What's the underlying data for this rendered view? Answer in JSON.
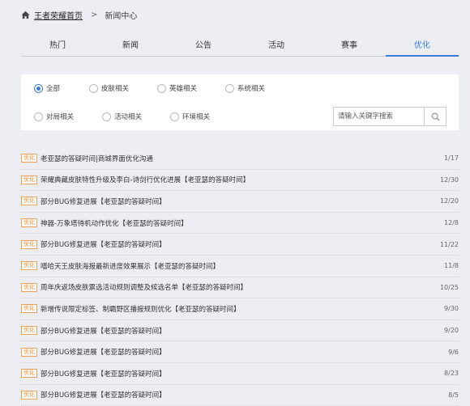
{
  "breadcrumb": {
    "home": "王者荣耀首页",
    "separator": ">",
    "current": "新闻中心"
  },
  "tabs": [
    {
      "label": "热门"
    },
    {
      "label": "新闻"
    },
    {
      "label": "公告"
    },
    {
      "label": "活动"
    },
    {
      "label": "赛事"
    },
    {
      "label": "优化"
    }
  ],
  "filters": [
    {
      "label": "全部"
    },
    {
      "label": "皮肤相关"
    },
    {
      "label": "英雄相关"
    },
    {
      "label": "系统相关"
    },
    {
      "label": "对局相关"
    },
    {
      "label": "活动相关"
    },
    {
      "label": "环境相关"
    }
  ],
  "search": {
    "placeholder": "请输入关键字搜索"
  },
  "news": [
    {
      "tag": "优化",
      "title": "老亚瑟的答疑时间|商城界面优化沟通",
      "date": "1/17"
    },
    {
      "tag": "优化",
      "title": "荣耀典藏皮肤特性升级及李白-诗剑行优化进展【老亚瑟的答疑时间】",
      "date": "12/30"
    },
    {
      "tag": "优化",
      "title": "部分BUG修复进展【老亚瑟的答疑时间】",
      "date": "12/20"
    },
    {
      "tag": "优化",
      "title": "神器-万象塔待机动作优化【老亚瑟的答疑时间】",
      "date": "12/8"
    },
    {
      "tag": "优化",
      "title": "部分BUG修复进展【老亚瑟的答疑时间】",
      "date": "11/22"
    },
    {
      "tag": "优化",
      "title": "嘻哈天王皮肤海报最新进度效果展示【老亚瑟的答疑时间】",
      "date": "11/8"
    },
    {
      "tag": "优化",
      "title": "周年庆返场皮肤票选活动规则调整及候选名单【老亚瑟的答疑时间】",
      "date": "10/25"
    },
    {
      "tag": "优化",
      "title": "新增传说限定标签、制霸野区播报规则优化【老亚瑟的答疑时间】",
      "date": "9/30"
    },
    {
      "tag": "优化",
      "title": "部分BUG修复进展【老亚瑟的答疑时间】",
      "date": "9/20"
    },
    {
      "tag": "优化",
      "title": "部分BUG修复进展【老亚瑟的答疑时间】",
      "date": "9/6"
    },
    {
      "tag": "优化",
      "title": "部分BUG修复进展【老亚瑟的答疑时间】",
      "date": "8/23"
    },
    {
      "tag": "优化",
      "title": "部分BUG修复进展【老亚瑟的答疑时间】",
      "date": "8/5"
    }
  ],
  "colors": {
    "accent": "#3a7ad7",
    "tag": "#f08a33",
    "background": "#eceef3"
  },
  "icons": {
    "home": "home-icon",
    "search": "search-icon"
  }
}
